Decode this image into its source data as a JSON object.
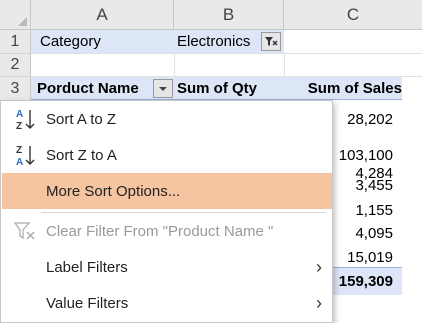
{
  "columns": [
    "A",
    "B",
    "C"
  ],
  "rows": [
    "1",
    "2",
    "3"
  ],
  "cells": {
    "a1": "Category",
    "b1": "Electronics",
    "a3": "Porduct Name",
    "b3": "Sum of Qty",
    "c3": "Sum of Sales"
  },
  "sales_values": [
    "28,202",
    "103,100",
    "4,284",
    "3,455",
    "1,155",
    "4,095",
    "15,019",
    "159,309"
  ],
  "menu": {
    "sort_az": {
      "label": "Sort A to Z",
      "icon": "sort-a-to-z-icon"
    },
    "sort_za": {
      "label": "Sort Z to A",
      "icon": "sort-z-to-a-icon"
    },
    "more_sort": {
      "label": "More Sort Options..."
    },
    "clear_filter": {
      "label": "Clear Filter From \"Product Name \"",
      "icon": "clear-filter-icon"
    },
    "label_filters": {
      "label": "Label Filters"
    },
    "value_filters": {
      "label": "Value Filters"
    },
    "submenu_arrow": "›"
  },
  "colors": {
    "pivot_header_bg": "#dce6f7",
    "highlight": "#f5c4a1",
    "sort_icon_blue": "#2b6cc4"
  }
}
